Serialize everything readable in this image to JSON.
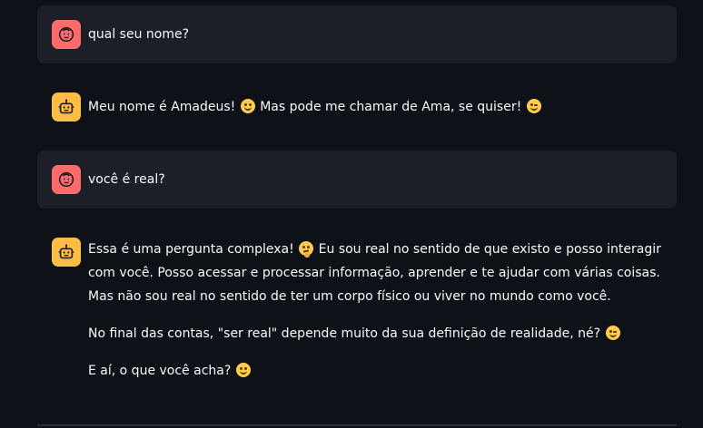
{
  "messages": [
    {
      "role": "user",
      "avatar_icon": "user-face-icon",
      "text": "qual seu nome?"
    },
    {
      "role": "assistant",
      "avatar_icon": "robot-icon",
      "text_parts": [
        "Meu nome é Amadeus!",
        "Mas pode me chamar de Ama, se quiser!"
      ]
    },
    {
      "role": "user",
      "avatar_icon": "user-face-icon",
      "text": "você é real?"
    },
    {
      "role": "assistant",
      "avatar_icon": "robot-icon",
      "p1_a": "Essa é uma pergunta complexa!",
      "p1_b": "Eu sou real no sentido de que existo e posso interagir com você. Posso acessar e processar informação, aprender e te ajudar com várias coisas. Mas não sou real no sentido de ter um corpo físico ou viver no mundo como você.",
      "p2": "No final das contas, \"ser real\" depende muito da sua definição de realidade, né?",
      "p3": "E aí, o que você acha?"
    }
  ],
  "colors": {
    "background": "#0e1117",
    "user_bubble": "#1c1f28",
    "user_avatar": "#ff6b6b",
    "bot_avatar": "#ffbd45",
    "text": "#fafafa"
  }
}
